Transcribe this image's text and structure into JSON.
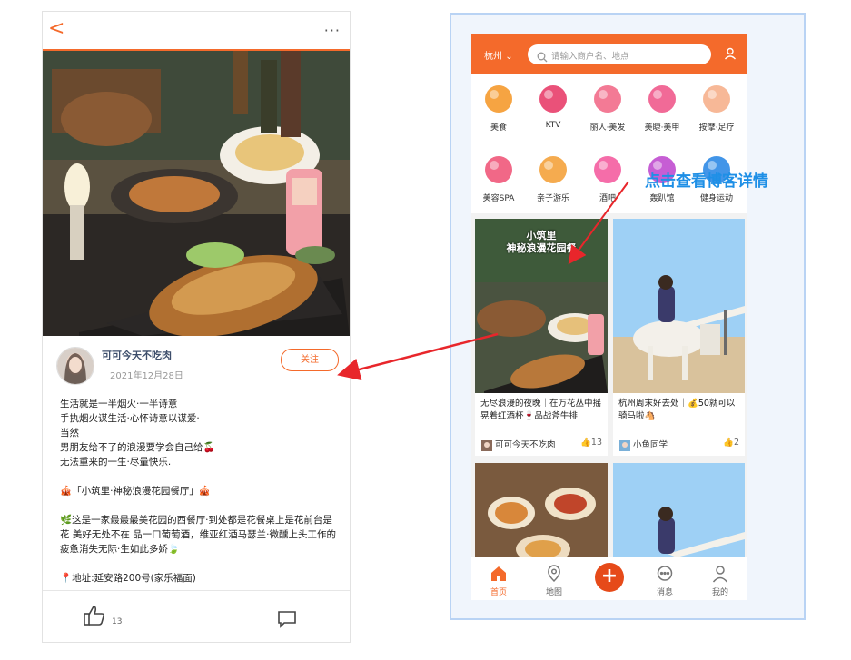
{
  "detail": {
    "back_glyph": "<",
    "more_glyph": "···",
    "author": {
      "name": "可可今天不吃肉",
      "date": "2021年12月28日"
    },
    "follow_label": "关注",
    "body_lines": [
      "生活就是一半烟火·一半诗意",
      "手执烟火谋生活·心怀诗意以谋爱·",
      "当然",
      "男朋友给不了的浪漫要学会自己给🍒",
      "无法重来的一生·尽量快乐.",
      "",
      "🎪「小筑里·神秘浪漫花园餐厅」🎪",
      "",
      "🌿这是一家最最最美花园的西餐厅·到处都是花餐桌上是花前台是花 美好无处不在 品一口葡萄酒，维亚红酒马瑟兰·微醺上头工作的疲惫消失无际·生如此多娇🍃",
      "",
      "📍地址:延安路200号(家乐福面)"
    ],
    "like_count": "13"
  },
  "home": {
    "city": "杭州",
    "search_placeholder": "请输入商户名、地点",
    "categories": [
      {
        "label": "美食",
        "icon": "roast-chicken-icon",
        "color": "#f59a2e"
      },
      {
        "label": "KTV",
        "icon": "microphone-icon",
        "color": "#e83e6a"
      },
      {
        "label": "丽人·美发",
        "icon": "hair-icon",
        "color": "#f26b8a"
      },
      {
        "label": "美睫·美甲",
        "icon": "nail-icon",
        "color": "#f05a8c"
      },
      {
        "label": "按摩·足疗",
        "icon": "foot-icon",
        "color": "#f6b08c"
      },
      {
        "label": "美容SPA",
        "icon": "face-mask-icon",
        "color": "#f0587a"
      },
      {
        "label": "亲子游乐",
        "icon": "family-icon",
        "color": "#f4a23c"
      },
      {
        "label": "酒吧",
        "icon": "cocktail-icon",
        "color": "#f45da0"
      },
      {
        "label": "轰趴馆",
        "icon": "party-mask-icon",
        "color": "#c04ccf"
      },
      {
        "label": "健身运动",
        "icon": "dumbbell-icon",
        "color": "#2e8ae6"
      }
    ],
    "cards": [
      {
        "overlay": "小筑里\n神秘浪漫花园餐",
        "title": "无尽浪漫的夜晚｜在万花丛中摇晃着红酒杯🍷品战斧牛排",
        "author": "可可今天不吃肉",
        "likes": "13"
      },
      {
        "overlay": "",
        "title": "杭州周末好去处｜💰50就可以骑马啦🐴",
        "author": "小鱼同学",
        "likes": "2"
      }
    ],
    "tabs": [
      {
        "label": "首页",
        "icon": "home-icon"
      },
      {
        "label": "地图",
        "icon": "map-pin-icon"
      },
      {
        "label": "消息",
        "icon": "chat-icon"
      },
      {
        "label": "我的",
        "icon": "profile-icon"
      }
    ],
    "plus_glyph": "+"
  },
  "annotation": "点击查看博客详情",
  "colors": {
    "accent": "#f46a2b",
    "arrow": "#e8262b",
    "annotation": "#1e8fe6"
  }
}
